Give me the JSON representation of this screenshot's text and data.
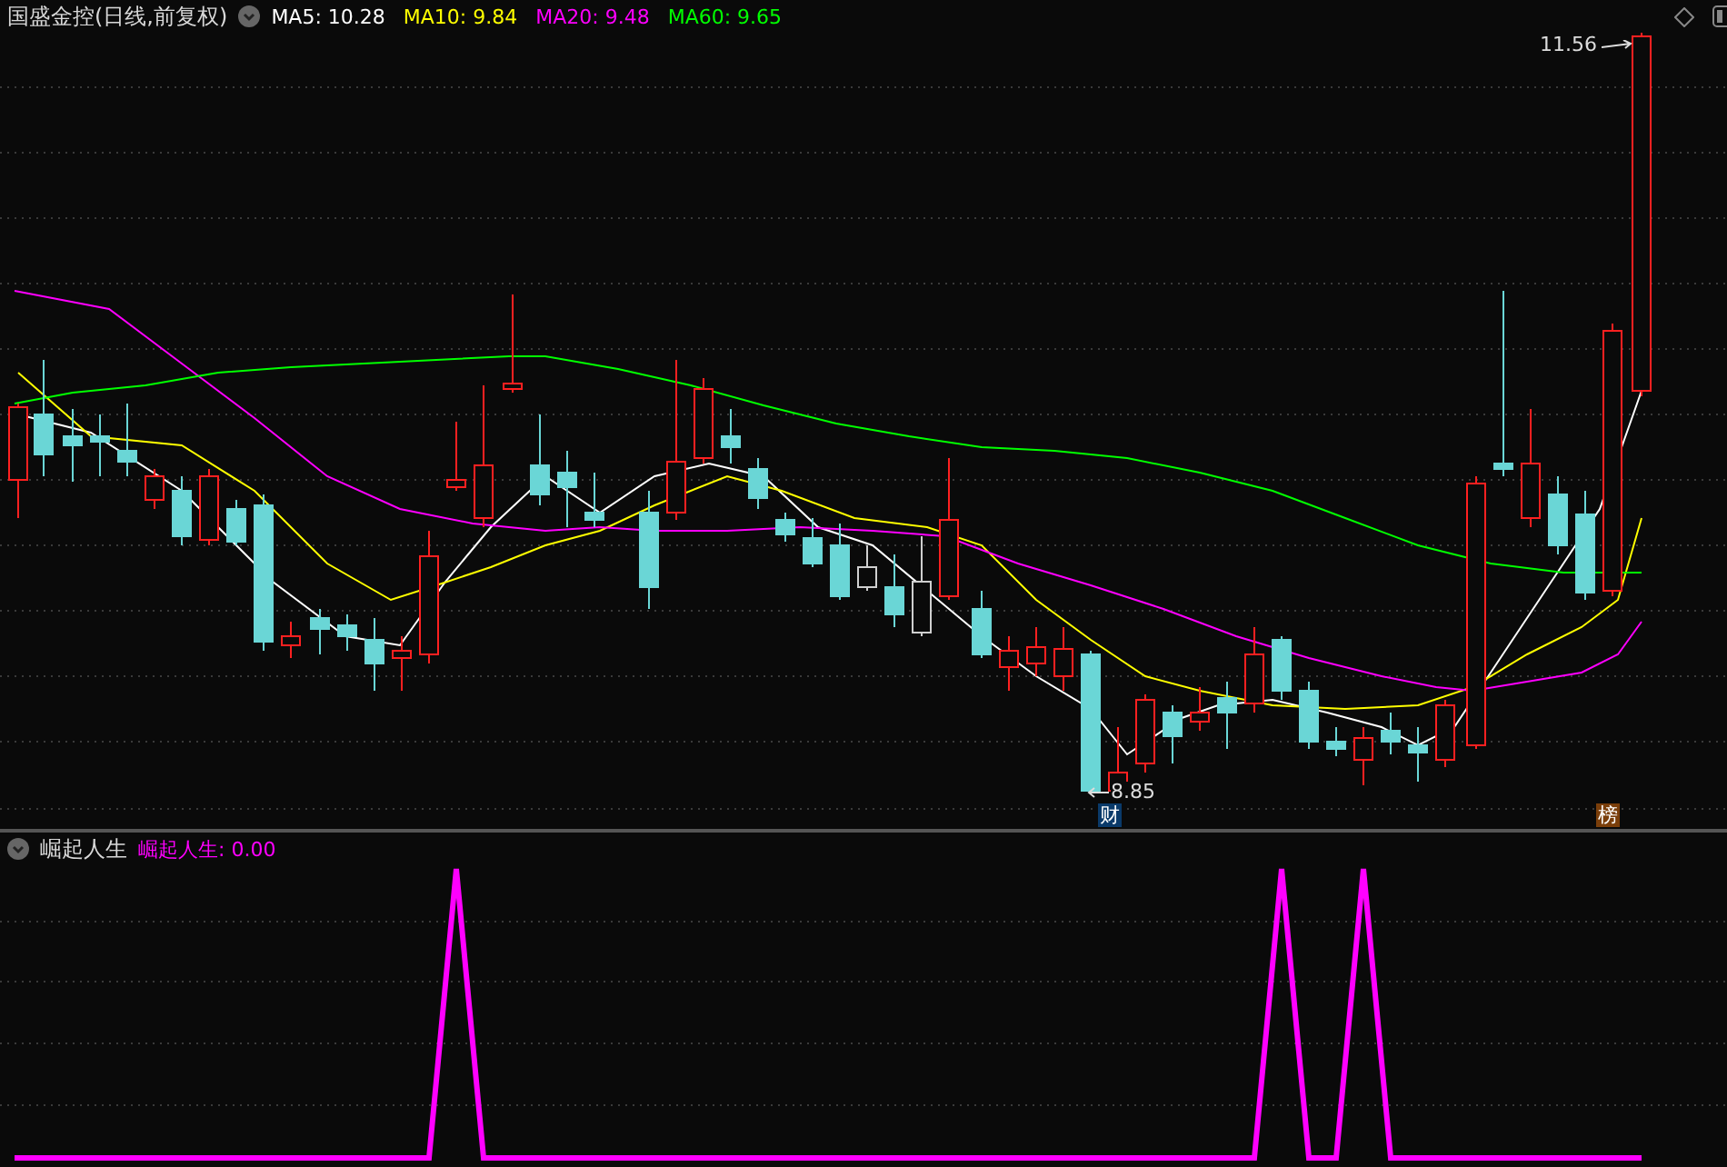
{
  "chart_header": {
    "title": "国盛金控(日线,前复权)",
    "ma": [
      {
        "label": "MA5: 10.28",
        "color": "#ffffff"
      },
      {
        "label": "MA10: 9.84",
        "color": "#ffff00"
      },
      {
        "label": "MA20: 9.48",
        "color": "#ff00ff"
      },
      {
        "label": "MA60: 9.65",
        "color": "#00ff00"
      }
    ]
  },
  "price_chart": {
    "high_label": "11.56",
    "low_label": "8.85",
    "markers": [
      {
        "text": "财",
        "color": "#0a3a6a"
      },
      {
        "text": "榜",
        "color": "#7a3e0a"
      }
    ]
  },
  "indicator": {
    "title": "崛起人生",
    "reading": "崛起人生: 0.00"
  }
}
